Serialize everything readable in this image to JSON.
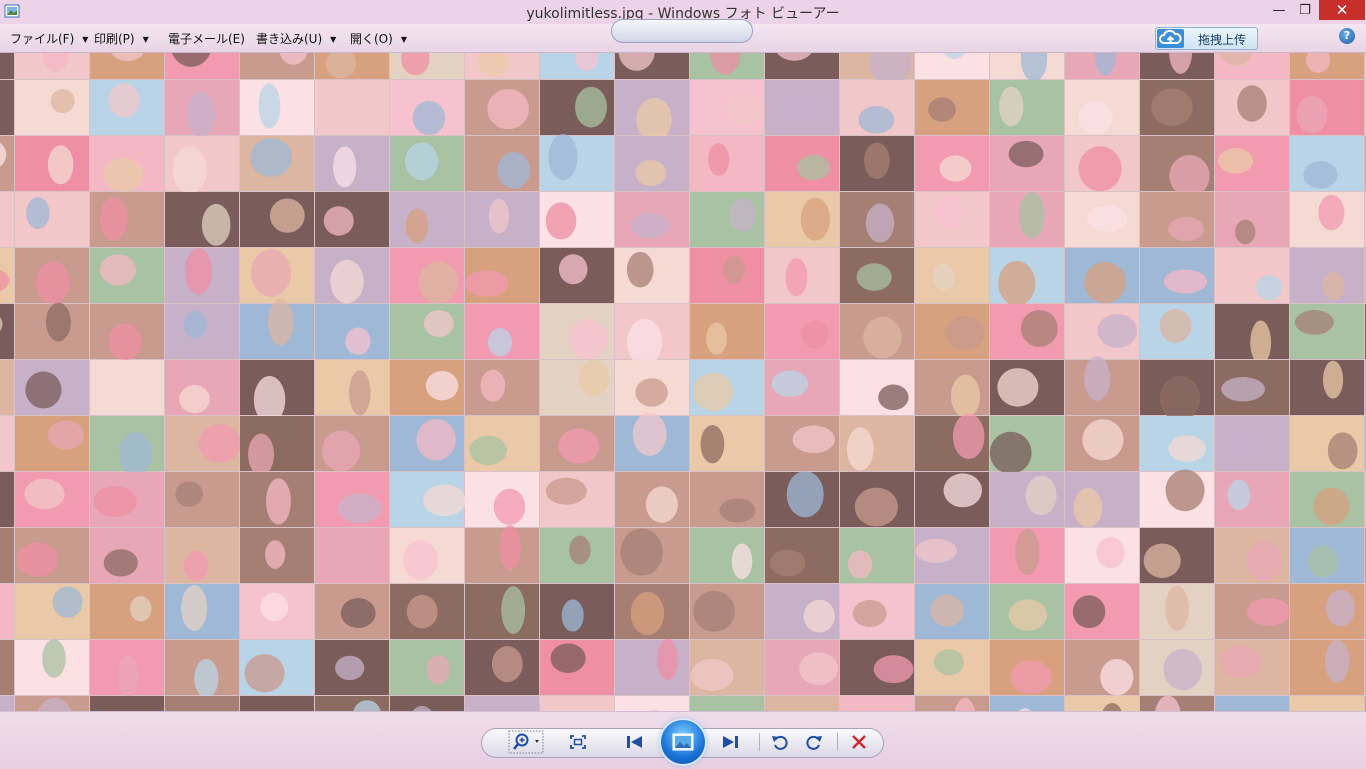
{
  "window": {
    "title": "yukolimitless.jpg - Windows フォト ビューアー",
    "minimize_glyph": "—",
    "maximize_glyph": "❐",
    "close_glyph": "✕"
  },
  "menubar": {
    "items": [
      {
        "label": "ファイル(F)",
        "has_dropdown": true
      },
      {
        "label": "印刷(P)",
        "has_dropdown": true
      },
      {
        "label": "電子メール(E)",
        "has_dropdown": false
      },
      {
        "label": "書き込み(U)",
        "has_dropdown": true
      },
      {
        "label": "開く(O)",
        "has_dropdown": true
      }
    ],
    "upload_button": {
      "label": "拖拽上传",
      "icon": "cloud-upload-icon"
    },
    "help": {
      "label": "?",
      "icon": "help-icon"
    }
  },
  "viewer": {
    "image_name": "yukolimitless.jpg",
    "mosaic_palette": [
      "#e8a7b6",
      "#f2c7c9",
      "#c99a8e",
      "#a67f74",
      "#f5d9d3",
      "#dcb6a1",
      "#ee8fa3",
      "#9fb8d6",
      "#f7c2cf",
      "#7a5c5a",
      "#e3d2c4",
      "#f19ab0",
      "#b9d4e6",
      "#d7a07f",
      "#fbe0e4",
      "#c7b1c9",
      "#8c6b62",
      "#f4b8c4",
      "#e9c9a7",
      "#a8c2a3"
    ]
  },
  "toolbar": {
    "zoom": {
      "icon": "zoom-icon"
    },
    "actual_size": {
      "icon": "actual-size-icon"
    },
    "previous": {
      "icon": "previous-icon"
    },
    "slideshow": {
      "icon": "slideshow-icon"
    },
    "next": {
      "icon": "next-icon"
    },
    "rotate_ccw": {
      "icon": "rotate-counterclockwise-icon"
    },
    "rotate_cw": {
      "icon": "rotate-clockwise-icon"
    },
    "delete": {
      "icon": "delete-icon"
    }
  },
  "colors": {
    "chrome_bg": "#ecd3e7",
    "close_button": "#c7302a",
    "accent_blue": "#1a73d6",
    "delete_red": "#d0282a"
  }
}
